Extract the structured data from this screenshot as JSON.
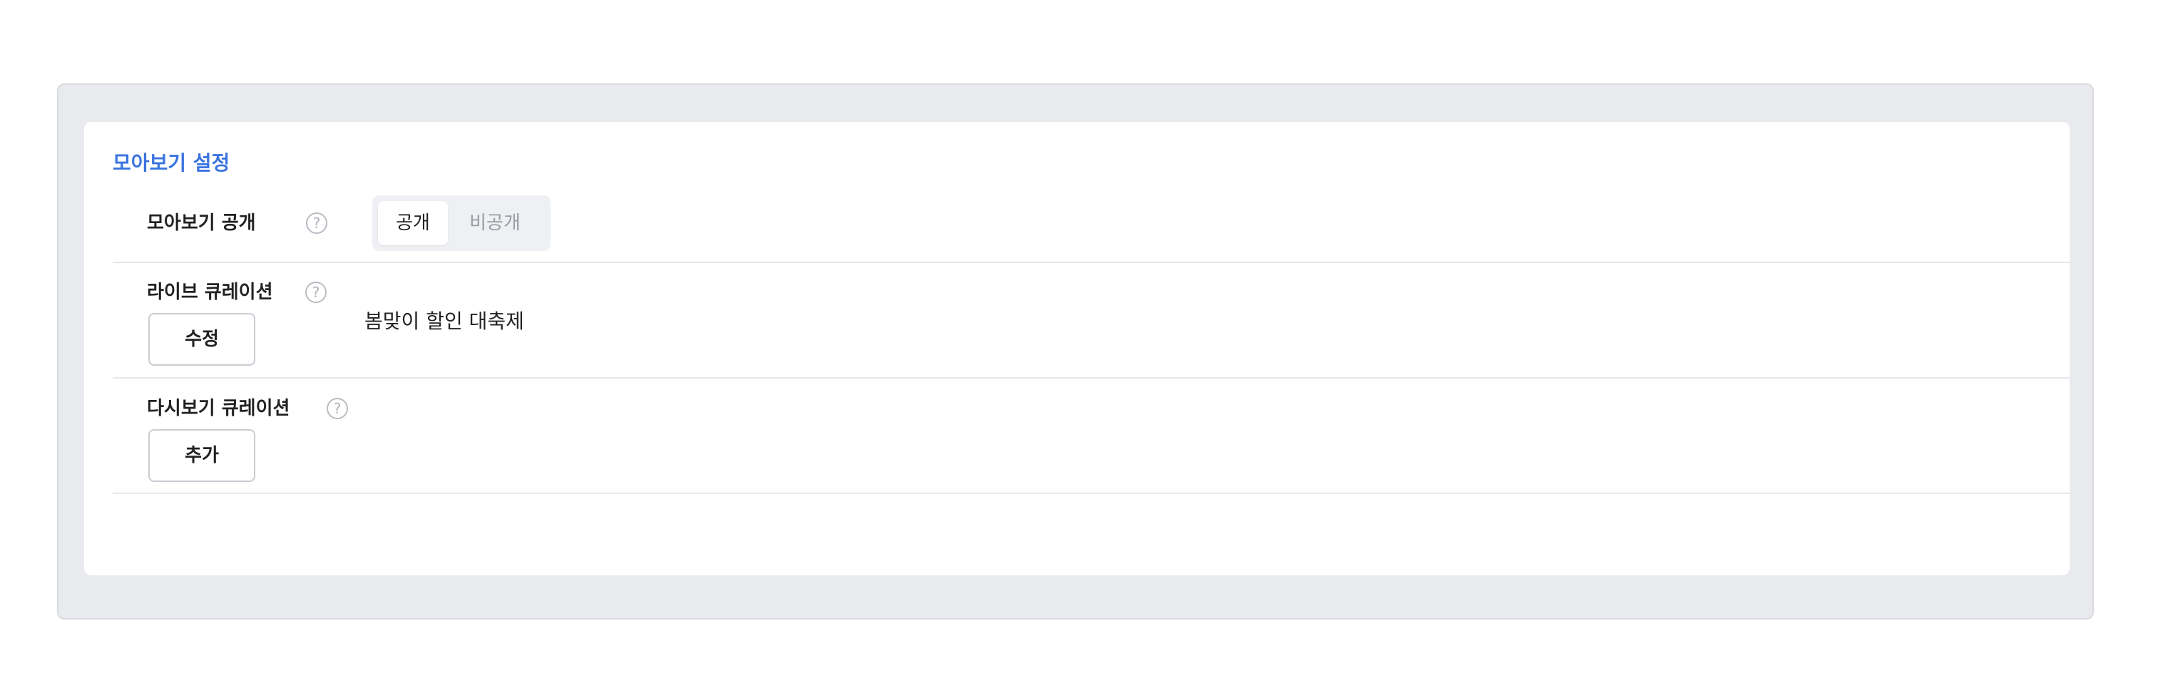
{
  "settings": {
    "title": "모아보기 설정",
    "visibility": {
      "label": "모아보기 공개",
      "help_icon": "question-circle-icon",
      "options": [
        "공개",
        "비공개"
      ],
      "selected": "공개"
    },
    "live_curation": {
      "label": "라이브 큐레이션",
      "help_icon": "question-circle-icon",
      "button_label": "수정",
      "value": "봄맞이 할인 대축제"
    },
    "replay_curation": {
      "label": "다시보기 큐레이션",
      "help_icon": "question-circle-icon",
      "button_label": "추가"
    }
  },
  "colors": {
    "accent": "#3a74e0",
    "outer_bg": "#e9eaed"
  }
}
